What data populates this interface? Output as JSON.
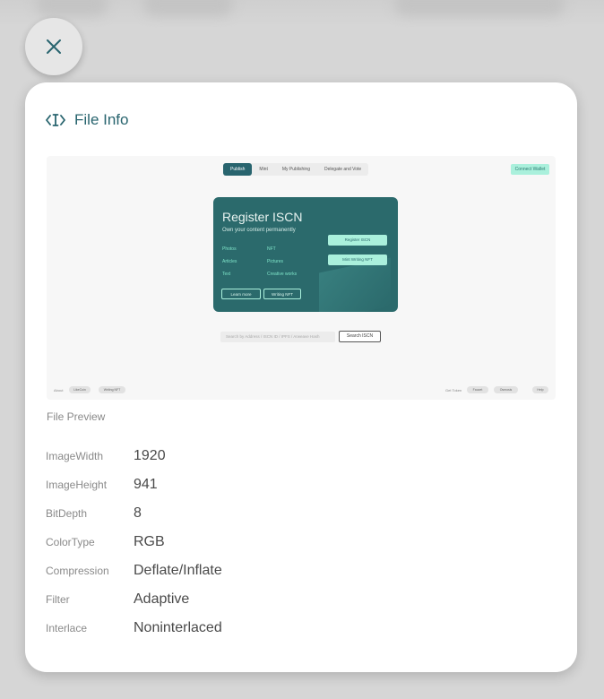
{
  "dialog": {
    "title": "File Info",
    "preview_caption": "File Preview"
  },
  "preview": {
    "nav": [
      "Publish",
      "Mint",
      "My Publishing",
      "Delegate and Vote"
    ],
    "connect_wallet": "Connect Wallet",
    "hero_title": "Register ISCN",
    "hero_subtitle": "Own your content permanently",
    "hero_items": [
      "Photos",
      "NFT",
      "Articles",
      "Pictures",
      "Text",
      "Creative works"
    ],
    "hero_primary": "Register ISCN",
    "hero_secondary": "Mint Writing NFT",
    "hero_learn_more": "Learn more",
    "hero_writing": "Writing NFT",
    "search_placeholder": "Search by Address / ISCN ID / IPFS / Arweave Hash",
    "search_button": "Search ISCN",
    "footer_left_label": "About",
    "footer_left_chips": [
      "LikeCoin",
      "Writing NFT"
    ],
    "footer_right_label": "Get Token",
    "footer_right_chips": [
      "Faucet",
      "Osmosis",
      "Help"
    ]
  },
  "file_info": [
    {
      "key": "ImageWidth",
      "value": "1920"
    },
    {
      "key": "ImageHeight",
      "value": "941"
    },
    {
      "key": "BitDepth",
      "value": "8"
    },
    {
      "key": "ColorType",
      "value": "RGB"
    },
    {
      "key": "Compression",
      "value": "Deflate/Inflate"
    },
    {
      "key": "Filter",
      "value": "Adaptive"
    },
    {
      "key": "Interlace",
      "value": "Noninterlaced"
    }
  ],
  "colors": {
    "accent": "#28646e",
    "hero_bg": "#2b6a6c",
    "mint": "#aaf0dc"
  },
  "icons": {
    "close": "close-icon",
    "file_info": "code-cursor-icon"
  }
}
